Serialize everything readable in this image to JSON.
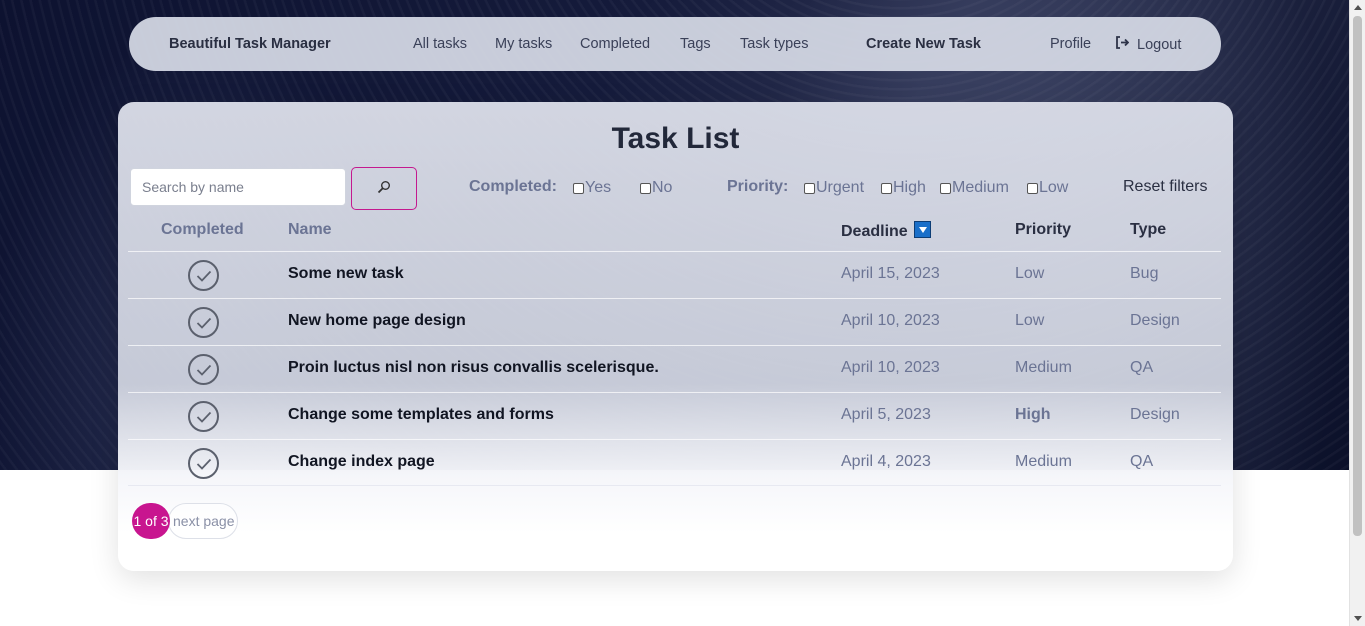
{
  "navbar": {
    "brand": "Beautiful Task Manager",
    "links": [
      "All tasks",
      "My tasks",
      "Completed",
      "Tags",
      "Task types"
    ],
    "create": "Create New Task",
    "profile": "Profile",
    "logout": "Logout"
  },
  "page": {
    "title": "Task List"
  },
  "search": {
    "placeholder": "Search by name",
    "value": ""
  },
  "filters": {
    "completed_label": "Completed:",
    "completed_options": [
      "Yes",
      "No"
    ],
    "priority_label": "Priority:",
    "priority_options": [
      "Urgent",
      "High",
      "Medium",
      "Low"
    ],
    "reset": "Reset filters"
  },
  "table": {
    "headers": {
      "completed": "Completed",
      "name": "Name",
      "deadline": "Deadline",
      "priority": "Priority",
      "type": "Type"
    },
    "rows": [
      {
        "name": "Some new task",
        "deadline": "April 15, 2023",
        "priority": "Low",
        "type": "Bug"
      },
      {
        "name": "New home page design",
        "deadline": "April 10, 2023",
        "priority": "Low",
        "type": "Design"
      },
      {
        "name": "Proin luctus nisl non risus convallis scelerisque.",
        "deadline": "April 10, 2023",
        "priority": "Medium",
        "type": "QA"
      },
      {
        "name": "Change some templates and forms",
        "deadline": "April 5, 2023",
        "priority": "High",
        "type": "Design"
      },
      {
        "name": "Change index page",
        "deadline": "April 4, 2023",
        "priority": "Medium",
        "type": "QA"
      }
    ]
  },
  "pagination": {
    "current": "1 of 3",
    "next": "next page"
  },
  "colors": {
    "accent": "#c8158f",
    "sort_icon": "#1a6fc9"
  },
  "icons": {
    "search": "search-icon",
    "logout": "logout-icon",
    "check": "check-circle-icon",
    "sort": "sort-down-icon"
  }
}
